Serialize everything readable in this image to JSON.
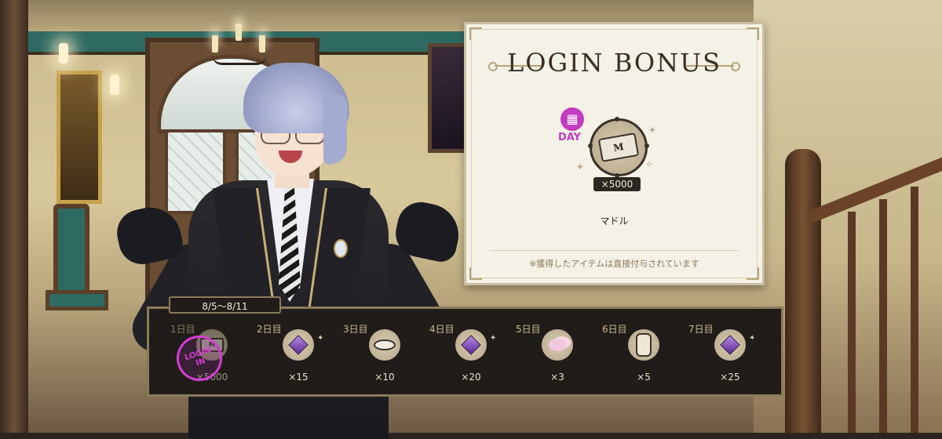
{
  "login_bonus": {
    "title": "LOGIN BONUS",
    "today": {
      "day_label": "DAY",
      "item_icon": "madol-coin-icon",
      "quantity": "×5000",
      "item_name": "マドル"
    },
    "note": "※獲得したアイテムは直接付与されています"
  },
  "week": {
    "date_range": "8/5～8/11",
    "days": [
      {
        "label": "1日目",
        "icon": "madol-coin-icon",
        "quantity": "×5000",
        "claimed": true
      },
      {
        "label": "2日目",
        "icon": "magical-gem-icon",
        "quantity": "×15",
        "claimed": false
      },
      {
        "label": "3日目",
        "icon": "cookie-plate-icon",
        "quantity": "×10",
        "claimed": false
      },
      {
        "label": "4日目",
        "icon": "magical-gem-icon",
        "quantity": "×20",
        "claimed": false
      },
      {
        "label": "5日目",
        "icon": "cotton-puff-icon",
        "quantity": "×3",
        "claimed": false
      },
      {
        "label": "6日目",
        "icon": "tiered-stand-icon",
        "quantity": "×5",
        "claimed": false
      },
      {
        "label": "7日目",
        "icon": "magical-gem-icon",
        "quantity": "×25",
        "claimed": false
      }
    ]
  },
  "colors": {
    "accent_magenta": "#c43cc0",
    "panel_dark": "#201c19",
    "card_bg": "#f4f1e6",
    "gold_border": "#8a7b5a"
  }
}
